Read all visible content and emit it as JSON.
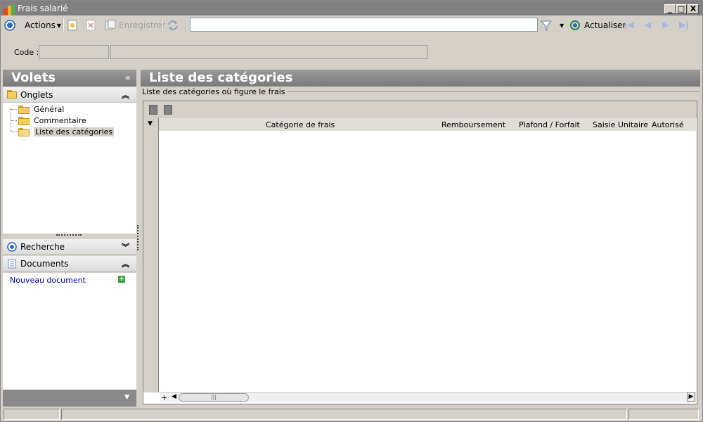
{
  "window": {
    "title": "Frais salarié",
    "min_glyph": "_",
    "max_glyph": "□",
    "close_glyph": "X"
  },
  "toolbar": {
    "actions_label": "Actions",
    "save_label": "Enregistrer",
    "search_value": "",
    "refresh_label": "Actualiser"
  },
  "form": {
    "code_label": "Code :"
  },
  "left_pane": {
    "title": "Volets",
    "collapse_glyph": "«",
    "tabs_section": {
      "label": "Onglets",
      "items": [
        {
          "label": "Général"
        },
        {
          "label": "Commentaire"
        },
        {
          "label": "Liste des catégories"
        }
      ]
    },
    "search_section": {
      "label": "Recherche"
    },
    "documents_section": {
      "label": "Documents",
      "new_document": "Nouveau document"
    }
  },
  "main": {
    "title": "Liste des catégories",
    "group_label": "Liste des catégories où figure le frais",
    "grid": {
      "columns": [
        "Catégorie de frais",
        "Remboursement",
        "Plafond / Forfait",
        "Saisie Unitaire",
        "Autorisé"
      ],
      "rows": []
    }
  },
  "colors": {
    "header_gray": "#808080",
    "link_blue": "#0000c0",
    "window_bg": "#d4d0c8"
  }
}
